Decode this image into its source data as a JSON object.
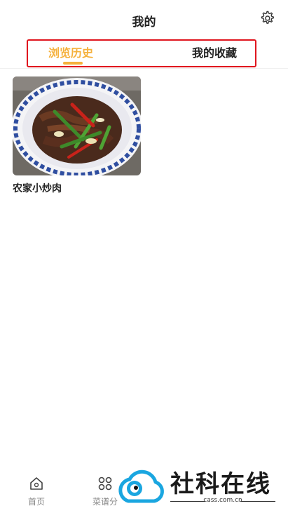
{
  "header": {
    "title": "我的"
  },
  "tabs": [
    {
      "label": "浏览历史",
      "active": true
    },
    {
      "label": "我的收藏",
      "active": false
    }
  ],
  "colors": {
    "accent": "#f5b13c",
    "highlight_box": "#e0151e"
  },
  "history": [
    {
      "title": "农家小炒肉",
      "image": "stir-fried-pork-with-peppers"
    }
  ],
  "bottom_nav": [
    {
      "label": "首页",
      "icon": "home-icon"
    },
    {
      "label": "菜谱分",
      "icon": "category-icon"
    }
  ],
  "watermark": {
    "name": "社科在线",
    "domain": "cass.com.cn"
  }
}
